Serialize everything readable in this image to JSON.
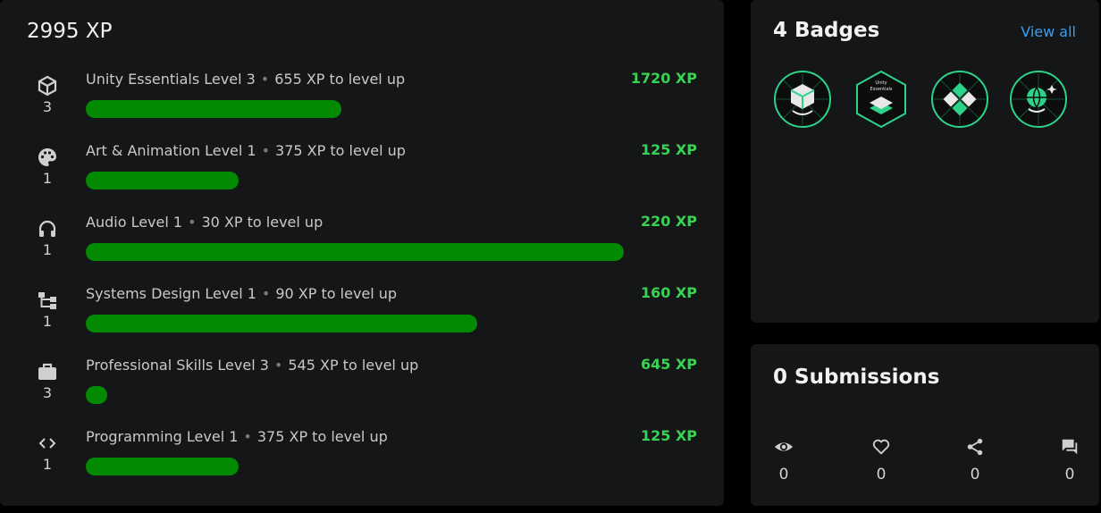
{
  "xp_panel": {
    "total": "2995 XP",
    "skills": [
      {
        "icon": "unity-cube-icon",
        "name": "Unity Essentials Level 3",
        "to_next": "655 XP to level up",
        "xp": "1720 XP",
        "level": "3",
        "progress": 0.418
      },
      {
        "icon": "palette-icon",
        "name": "Art & Animation Level 1",
        "to_next": "375 XP to level up",
        "xp": "125 XP",
        "level": "1",
        "progress": 0.25
      },
      {
        "icon": "headphones-icon",
        "name": "Audio Level 1",
        "to_next": "30 XP to level up",
        "xp": "220 XP",
        "level": "1",
        "progress": 0.88
      },
      {
        "icon": "hierarchy-icon",
        "name": "Systems Design Level 1",
        "to_next": "90 XP to level up",
        "xp": "160 XP",
        "level": "1",
        "progress": 0.64
      },
      {
        "icon": "briefcase-icon",
        "name": "Professional Skills Level 3",
        "to_next": "545 XP to level up",
        "xp": "645 XP",
        "level": "3",
        "progress": 0.035
      },
      {
        "icon": "code-icon",
        "name": "Programming Level 1",
        "to_next": "375 XP to level up",
        "xp": "125 XP",
        "level": "1",
        "progress": 0.25
      }
    ]
  },
  "badges_panel": {
    "title": "4 Badges",
    "view_all": "View all",
    "badges": [
      {
        "icon": "cube-badge-icon"
      },
      {
        "icon": "unity-essentials-badge-icon",
        "label_top": "Unity",
        "label_bottom": "Essentials"
      },
      {
        "icon": "grid-badge-icon"
      },
      {
        "icon": "globe-badge-icon"
      }
    ]
  },
  "submissions_panel": {
    "title": "0 Submissions",
    "stats": [
      {
        "icon": "eye-icon",
        "value": "0"
      },
      {
        "icon": "heart-icon",
        "value": "0"
      },
      {
        "icon": "share-icon",
        "value": "0"
      },
      {
        "icon": "comment-icon",
        "value": "0"
      }
    ]
  },
  "colors": {
    "background": "#000000",
    "card": "#151617",
    "progress_fill": "#028a02",
    "xp_text": "#39d353",
    "link": "#3d9cf0",
    "badge_accent": "#2ed38a"
  }
}
